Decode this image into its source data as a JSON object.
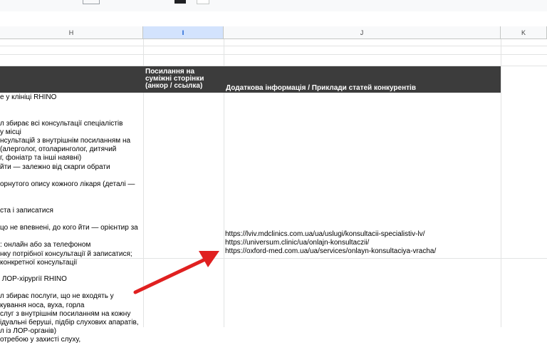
{
  "columns": [
    "H",
    "I",
    "J",
    "K"
  ],
  "selected_column": "I",
  "header": {
    "col_i": "Посилання на\nсуміжні сторінки\n(анкор / ссылка)",
    "col_j": "Додаткова інформація / Приклади статей конкурентів"
  },
  "cell_h_1": "е у клініці RHINO\n\n\nл збирає всі консультації спеціалістів\nу місці\nнсультацій з внутрішнім посиланням на\n(алерголог, отоларинголог, дитячий\nг, фоніатр та інші наявні)\nйти — залежно від скарги обрати\n\nорнутого опису кожного лікаря (деталі —\n\n\nста і записатися\n\nцо не впевнені, до кого йти — орієнтир за\n\n: онлайн або за телефоном\nнку потрібної консультації й записатися;\nконкретної консультації",
  "cell_h_2": " ЛОР-хірургії RHINO\n\nл збирає послуги, що не входять у\nкування носа, вуха, горла\nслуг з внутрішнім посиланням на кожну\nідуальні беруші, підбір слухових апаратів,\nл із ЛОР-органів)\nотребою у захисті слуху,",
  "cell_j_links": "https://lviv.mdclinics.com.ua/ua/uslugi/konsultacii-specialistiv-lv/\nhttps://universum.clinic/ua/onlajn-konsultaczii/\nhttps://oxford-med.com.ua/ua/services/onlayn-konsultaciya-vracha/",
  "colors": {
    "header_band": "#3c3c3c",
    "selected_column_header": "#d3e3fd",
    "annotation_arrow": "#e02020"
  }
}
